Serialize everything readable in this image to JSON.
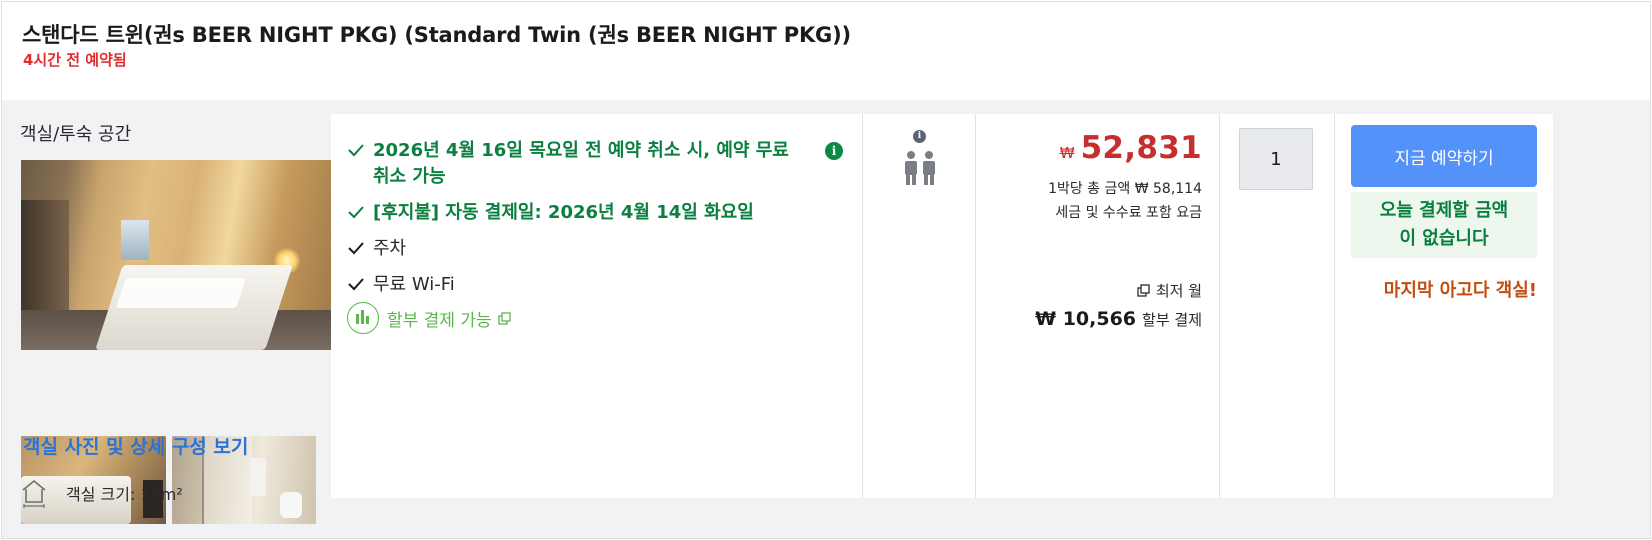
{
  "header": {
    "room_title": "스탠다드 트윈(권s BEER NIGHT PKG) (Standard Twin (권s BEER NIGHT PKG))",
    "booked_note": "4시간 전 예약됨"
  },
  "left": {
    "space_label": "객실/투숙 공간",
    "view_link": "객실 사진 및 상세 구성 보기",
    "room_size": "객실 크기: 19m²"
  },
  "benefits": {
    "items": [
      {
        "text": "2026년 4월 16일 목요일 전 예약 취소 시, 예약 무료 취소 가능",
        "style": "green",
        "icon": "check-icon"
      },
      {
        "text": "[후지불] 자동 결제일: 2026년 4월 14일 화요일",
        "style": "green",
        "icon": "check-icon"
      },
      {
        "text": "주차",
        "style": "dark",
        "icon": "check-icon"
      },
      {
        "text": "무료 Wi-Fi",
        "style": "dark",
        "icon": "check-icon"
      }
    ],
    "info_icon": "info-icon",
    "installment_label": "할부 결제 가능"
  },
  "occupancy": {
    "guests": 2,
    "icon": "two-people-icon"
  },
  "price": {
    "currency": "₩",
    "amount": "52,831",
    "per_night": "1박당 총 금액 ₩ 58,114",
    "tax_note": "세금 및 수수료 포함 요금",
    "min_month": "최저 월",
    "installment_amount": "₩ 10,566",
    "installment_label": "할부 결제"
  },
  "quantity": {
    "value": "1"
  },
  "booking": {
    "book_button": "지금 예약하기",
    "pay_today": "오늘 결제할 금액\n이 없습니다",
    "last_room": "마지막 아고다 객실!"
  },
  "colors": {
    "accent": "#5392f9",
    "price_red": "#c72e2e",
    "success_green": "#0a7f3f",
    "urgent_orange": "#c44d12",
    "booked_red": "#e12d2d"
  }
}
